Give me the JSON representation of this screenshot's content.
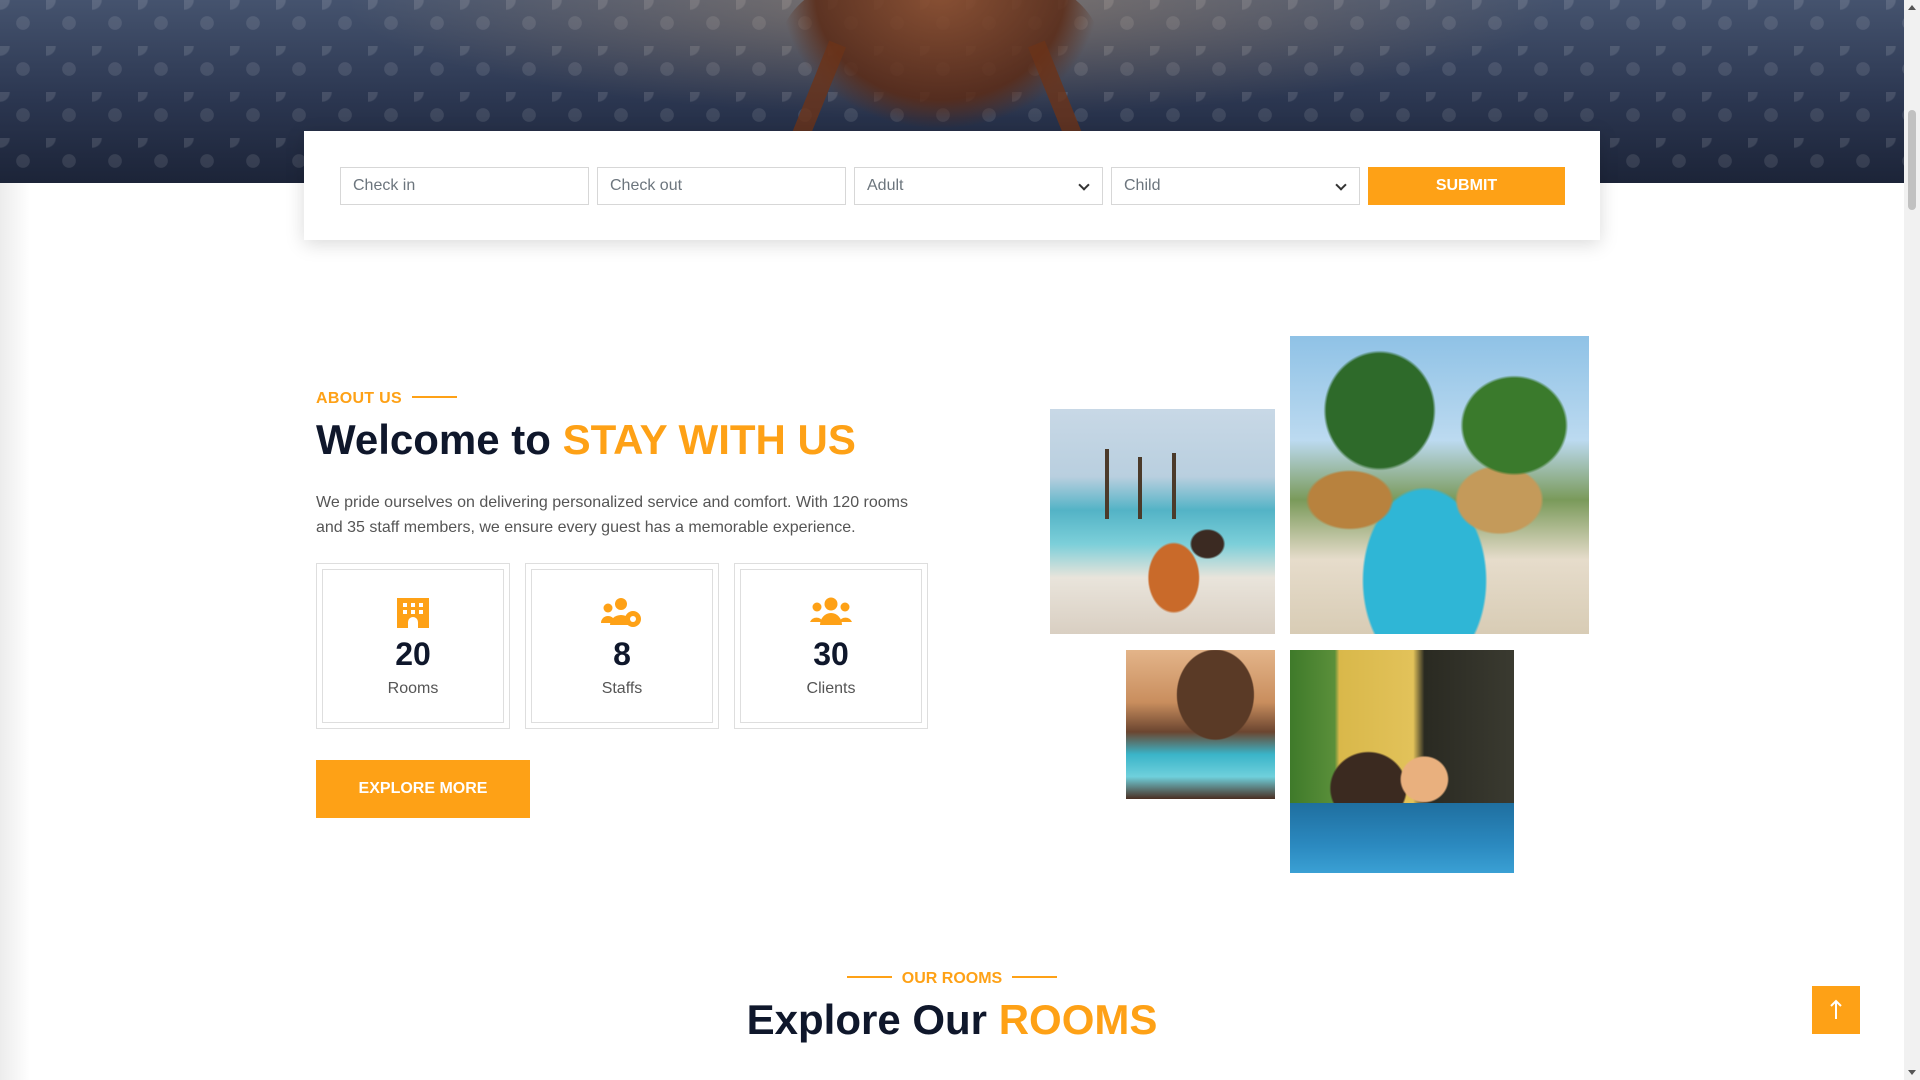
{
  "booking": {
    "check_in_placeholder": "Check in",
    "check_out_placeholder": "Check out",
    "adult_selected": "Adult",
    "child_selected": "Child",
    "submit_label": "SUBMIT"
  },
  "about": {
    "label": "ABOUT US",
    "title_prefix": "Welcome to",
    "title_accent": "STAY WITH US",
    "description": "We pride ourselves on delivering personalized service and comfort. With 120 rooms and 35 staff members, we ensure every guest has a memorable experience.",
    "stats": [
      {
        "icon": "hotel-icon",
        "number": "20",
        "label": "Rooms"
      },
      {
        "icon": "users-cog-icon",
        "number": "8",
        "label": "Staffs"
      },
      {
        "icon": "users-icon",
        "number": "30",
        "label": "Clients"
      }
    ],
    "explore_label": "EXPLORE MORE"
  },
  "rooms": {
    "label": "OUR ROOMS",
    "title_prefix": "Explore Our",
    "title_accent": "ROOMS"
  },
  "colors": {
    "accent": "#fea116",
    "dark": "#0f172b"
  },
  "icons": {
    "back_to_top": "arrow-up-icon"
  }
}
